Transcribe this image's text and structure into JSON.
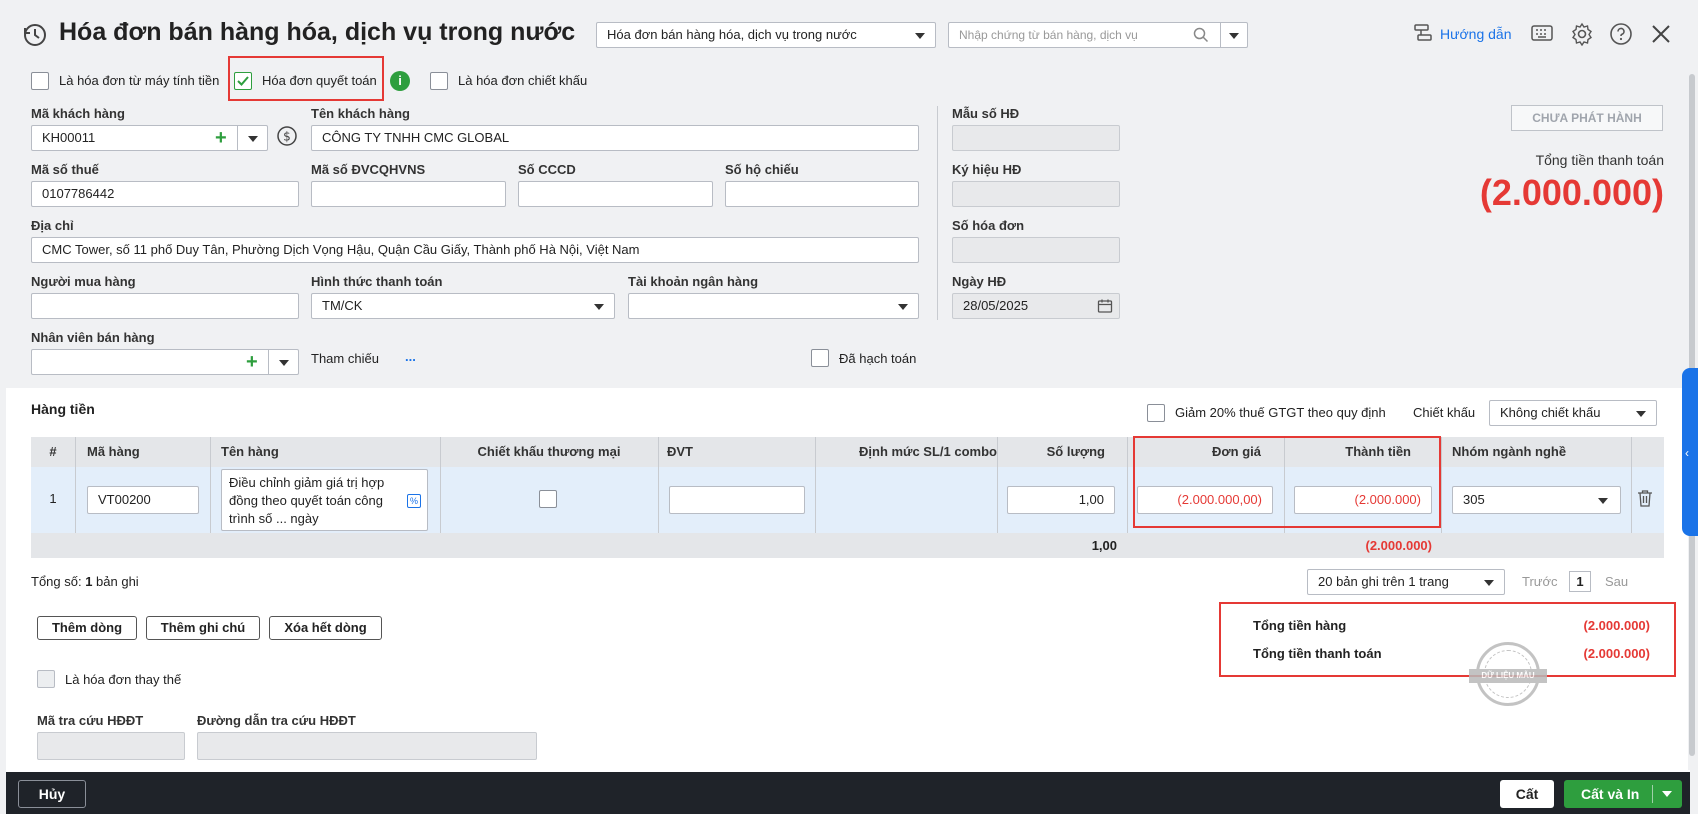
{
  "header": {
    "title": "Hóa đơn bán hàng hóa, dịch vụ trong nước",
    "type_select": "Hóa đơn bán hàng hóa, dịch vụ trong nước",
    "search_placeholder": "Nhập chứng từ bán hàng, dịch vụ",
    "help_label": "Hướng dẫn"
  },
  "options": {
    "cash_register": "Là hóa đơn từ máy tính tiền",
    "settlement": "Hóa đơn quyết toán",
    "discount": "Là hóa đơn chiết khấu"
  },
  "form": {
    "customer_code_label": "Mã khách hàng",
    "customer_code": "KH00011",
    "customer_name_label": "Tên khách hàng",
    "customer_name": "CÔNG TY TNHH CMC GLOBAL",
    "tax_code_label": "Mã số thuế",
    "tax_code": "0107786442",
    "budget_code_label": "Mã số ĐVCQHVNS",
    "citizen_id_label": "Số CCCD",
    "passport_label": "Số hộ chiếu",
    "address_label": "Địa chỉ",
    "address": "CMC Tower, số 11 phố Duy Tân, Phường Dịch Vọng Hậu, Quận Cầu Giấy, Thành phố Hà Nội, Việt Nam",
    "buyer_label": "Người mua hàng",
    "payment_label": "Hình thức thanh toán",
    "payment": "TM/CK",
    "bank_label": "Tài khoản ngân hàng",
    "salesperson_label": "Nhân viên bán hàng",
    "reference_label": "Tham chiếu",
    "reference_link": "...",
    "posted_label": "Đã hạch toán"
  },
  "invoice_info": {
    "template_label": "Mẫu số HĐ",
    "symbol_label": "Ký hiệu HĐ",
    "number_label": "Số hóa đơn",
    "date_label": "Ngày HĐ",
    "date": "28/05/2025"
  },
  "status": {
    "badge": "CHƯA PHÁT HÀNH",
    "total_label": "Tổng tiền thanh toán",
    "total_value": "(2.000.000)"
  },
  "goods": {
    "section_title": "Hàng tiền",
    "vat_reduction_label": "Giảm 20% thuế GTGT theo quy định",
    "discount_label": "Chiết khấu",
    "discount_value": "Không chiết khấu",
    "columns": [
      "#",
      "Mã hàng",
      "Tên hàng",
      "Chiết khấu thương mại",
      "ĐVT",
      "Định mức SL/1 combo",
      "Số lượng",
      "Đơn giá",
      "Thành tiền",
      "Nhóm ngành nghề"
    ],
    "row": {
      "index": "1",
      "item_code": "VT00200",
      "item_name": "Điều chỉnh giảm giá trị hợp đồng theo quyết toán công trình số ... ngày",
      "quantity": "1,00",
      "unit_price": "(2.000.000,00)",
      "amount": "(2.000.000)",
      "industry": "305"
    },
    "sum_quantity": "1,00",
    "sum_amount": "(2.000.000)"
  },
  "pagination": {
    "total_prefix": "Tổng số: ",
    "total_count": "1",
    "total_suffix": " bản ghi",
    "page_size": "20 bản ghi trên 1 trang",
    "prev": "Trước",
    "page": "1",
    "next": "Sau"
  },
  "actions": {
    "add_row": "Thêm dòng",
    "add_note": "Thêm ghi chú",
    "delete_all": "Xóa hết dòng"
  },
  "replacement_label": "Là hóa đơn thay thế",
  "lookup": {
    "code_label": "Mã tra cứu HĐĐT",
    "url_label": "Đường dẫn tra cứu HĐĐT"
  },
  "summary": {
    "goods_total_label": "Tổng tiền hàng",
    "goods_total": "(2.000.000)",
    "pay_total_label": "Tổng tiền thanh toán",
    "pay_total": "(2.000.000)",
    "stamp": "DỮ LIỆU MẪU"
  },
  "footer": {
    "cancel": "Hủy",
    "save": "Cất",
    "save_print": "Cất và In"
  },
  "colors": {
    "accent": "#1a73e8",
    "green": "#2e9e3e",
    "red": "#e53935",
    "footer_bg": "#1f2329"
  }
}
